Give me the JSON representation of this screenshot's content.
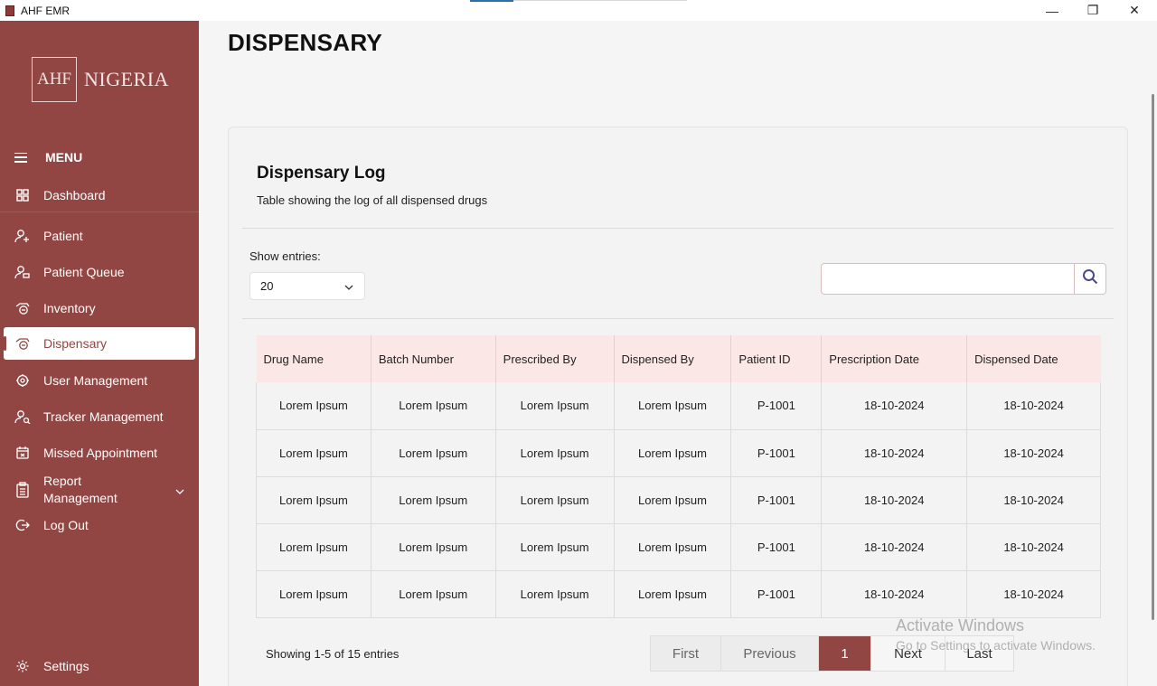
{
  "window": {
    "title": "AHF EMR",
    "minimize": "—",
    "maximize": "❐",
    "close": "✕"
  },
  "logo": {
    "mark": "AHF",
    "text": "NIGERIA"
  },
  "sidebar": {
    "menu_label": "MENU",
    "items": [
      {
        "label": "Dashboard",
        "icon": "dashboard-icon"
      },
      {
        "label": "Patient",
        "icon": "add-user-icon"
      },
      {
        "label": "Patient Queue",
        "icon": "queue-user-icon"
      },
      {
        "label": "Inventory",
        "icon": "inventory-icon"
      },
      {
        "label": "Dispensary",
        "icon": "pill-icon",
        "active": true
      },
      {
        "label": "User Management",
        "icon": "user-gear-icon"
      },
      {
        "label": "Tracker Management",
        "icon": "tracker-icon"
      },
      {
        "label": "Missed Appointment",
        "icon": "calendar-icon"
      },
      {
        "label": "Report Management",
        "icon": "clipboard-icon",
        "expandable": true
      },
      {
        "label": "Log Out",
        "icon": "logout-icon"
      }
    ],
    "settings_label": "Settings"
  },
  "page": {
    "title": "DISPENSARY"
  },
  "card": {
    "title": "Dispensary Log",
    "subtitle": "Table showing the log of all dispensed drugs",
    "show_entries_label": "Show entries:",
    "entries_value": "20",
    "search_value": "",
    "search_placeholder": ""
  },
  "table": {
    "headers": [
      "Drug Name",
      "Batch Number",
      "Prescribed By",
      "Dispensed By",
      "Patient ID",
      "Prescription Date",
      "Dispensed Date"
    ],
    "rows": [
      [
        "Lorem Ipsum",
        "Lorem Ipsum",
        "Lorem Ipsum",
        "Lorem Ipsum",
        "P-1001",
        "18-10-2024",
        "18-10-2024"
      ],
      [
        "Lorem Ipsum",
        "Lorem Ipsum",
        "Lorem Ipsum",
        "Lorem Ipsum",
        "P-1001",
        "18-10-2024",
        "18-10-2024"
      ],
      [
        "Lorem Ipsum",
        "Lorem Ipsum",
        "Lorem Ipsum",
        "Lorem Ipsum",
        "P-1001",
        "18-10-2024",
        "18-10-2024"
      ],
      [
        "Lorem Ipsum",
        "Lorem Ipsum",
        "Lorem Ipsum",
        "Lorem Ipsum",
        "P-1001",
        "18-10-2024",
        "18-10-2024"
      ],
      [
        "Lorem Ipsum",
        "Lorem Ipsum",
        "Lorem Ipsum",
        "Lorem Ipsum",
        "P-1001",
        "18-10-2024",
        "18-10-2024"
      ]
    ]
  },
  "pagination": {
    "summary": "Showing 1-5 of 15 entries",
    "first": "First",
    "previous": "Previous",
    "current": "1",
    "next": "Next",
    "last": "Last"
  },
  "watermark": {
    "line1": "Activate Windows",
    "line2": "Go to Settings to activate Windows."
  },
  "colors": {
    "sidebar": "#914643",
    "accent": "#914643",
    "header_row": "#fbe8e6",
    "card": "#f3f3f3"
  }
}
